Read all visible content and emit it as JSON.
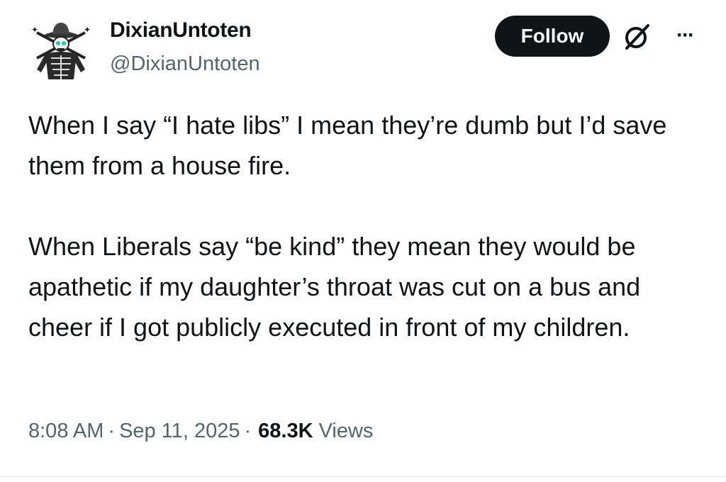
{
  "author": {
    "display_name": "DixianUntoten",
    "handle": "@DixianUntoten",
    "avatar_icon": "cowboy-skull-skeleton-avatar"
  },
  "actions": {
    "follow_label": "Follow",
    "grok_icon": "grok-icon",
    "more_icon": "more-options-icon",
    "more_glyph": "···"
  },
  "tweet": {
    "paragraph_1": "When I say “I hate libs” I mean they’re dumb but I’d save them from a house fire.",
    "paragraph_2": "When Liberals say “be kind” they mean they would be apathetic if my daughter’s throat was cut on a bus and cheer if I got publicly executed in front of my children."
  },
  "meta": {
    "time": "8:08 AM",
    "date": "Sep 11, 2025",
    "separator": "·",
    "views_count": "68.3K",
    "views_label": "Views"
  },
  "colors": {
    "text_primary": "#0f1419",
    "text_secondary": "#536471",
    "button_bg": "#0f1419",
    "button_text": "#ffffff",
    "avatar_eye": "#2ec4b6"
  }
}
